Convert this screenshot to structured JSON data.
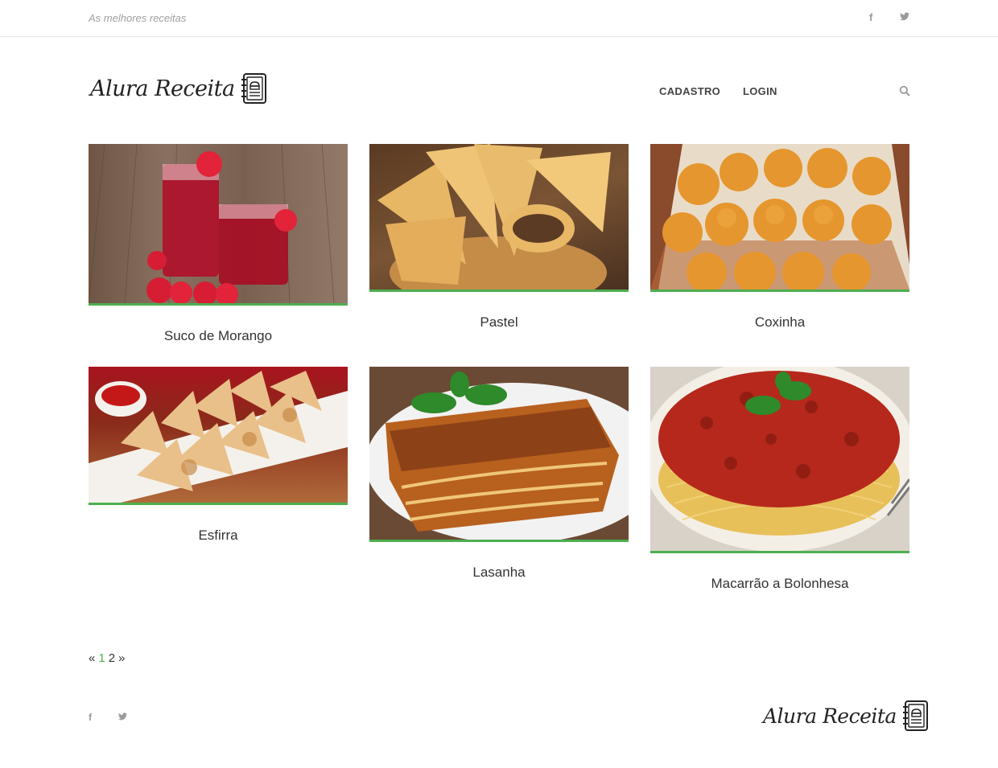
{
  "topbar": {
    "tagline": "As melhores receitas",
    "social": {
      "facebook_glyph": "f",
      "twitter_icon": "twitter-icon"
    }
  },
  "header": {
    "logo_text": "Alura Receita",
    "logo_icon": "recipe-book-icon",
    "nav": [
      "CADASTRO",
      "LOGIN"
    ],
    "search_icon": "search-icon"
  },
  "recipes": [
    {
      "title": "Suco de Morango"
    },
    {
      "title": "Pastel"
    },
    {
      "title": "Coxinha"
    },
    {
      "title": "Esfirra"
    },
    {
      "title": "Lasanha"
    },
    {
      "title": "Macarrão a Bolonhesa"
    }
  ],
  "pagination": {
    "prev": "«",
    "pages": [
      "1",
      "2"
    ],
    "current": "1",
    "next": "»"
  },
  "footer": {
    "logo_text": "Alura Receita",
    "facebook_glyph": "f"
  },
  "colors": {
    "accent": "#4caf50",
    "muted": "#9a9a9a"
  }
}
